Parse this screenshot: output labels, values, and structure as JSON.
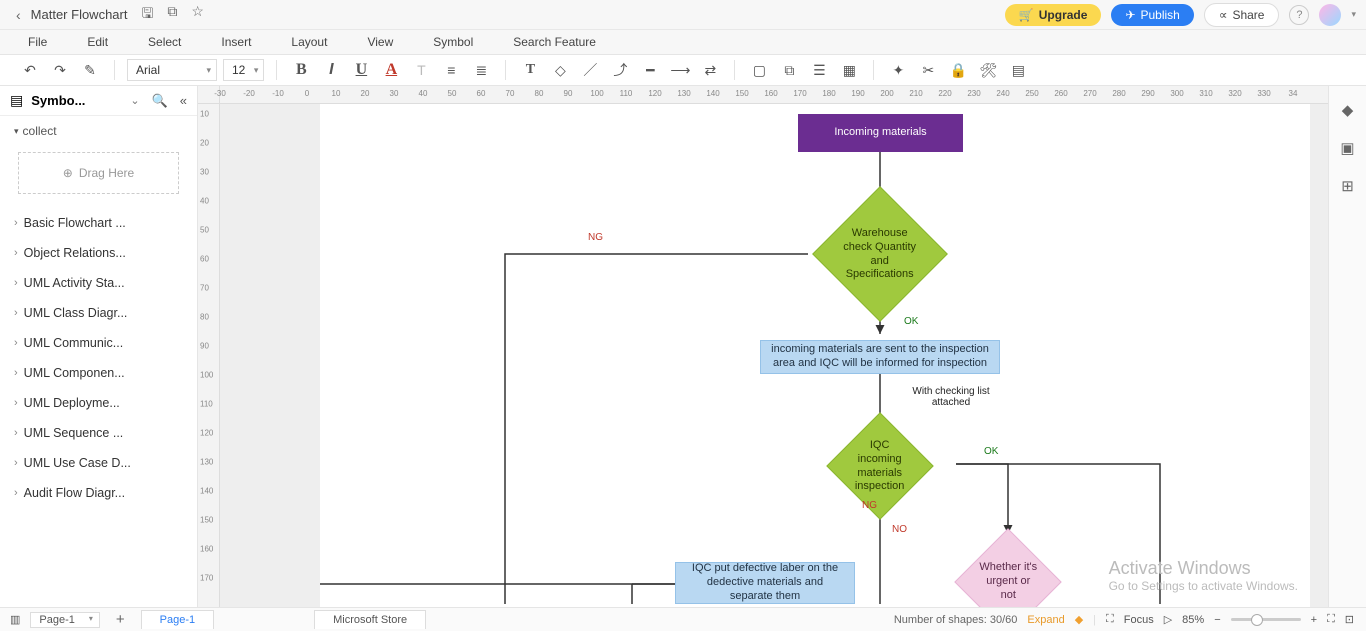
{
  "title": "Matter Flowchart",
  "menu": {
    "file": "File",
    "edit": "Edit",
    "select": "Select",
    "insert": "Insert",
    "layout": "Layout",
    "view": "View",
    "symbol": "Symbol",
    "search": "Search Feature"
  },
  "header_buttons": {
    "upgrade": "Upgrade",
    "publish": "Publish",
    "share": "Share"
  },
  "toolbar": {
    "font": "Arial",
    "font_size": "12"
  },
  "left_panel": {
    "header": "Symbo...",
    "collect": "collect",
    "drag": "Drag Here",
    "items": [
      "Basic Flowchart ...",
      "Object Relations...",
      "UML Activity Sta...",
      "UML Class Diagr...",
      "UML Communic...",
      "UML Componen...",
      "UML Deployme...",
      "UML Sequence ...",
      "UML Use Case D...",
      "Audit Flow Diagr..."
    ]
  },
  "hruler": [
    "-30",
    "-20",
    "-10",
    "0",
    "10",
    "20",
    "30",
    "40",
    "50",
    "60",
    "70",
    "80",
    "90",
    "100",
    "110",
    "120",
    "130",
    "140",
    "150",
    "160",
    "170",
    "180",
    "190",
    "200",
    "210",
    "220",
    "230",
    "240",
    "250",
    "260",
    "270",
    "280",
    "290",
    "300",
    "310",
    "320",
    "330",
    "34"
  ],
  "vruler": [
    "10",
    "20",
    "30",
    "40",
    "50",
    "60",
    "70",
    "80",
    "90",
    "100",
    "110",
    "120",
    "130",
    "140",
    "150",
    "160",
    "170"
  ],
  "nodes": {
    "incoming": "Incoming materials",
    "warehouse": "Warehouse check Quantity and Specifications",
    "send_iqc": "incoming materials are sent to the inspection area and IQC will be informed for inspection",
    "checking": "With checking list attached",
    "iqc_inspect": "IQC incoming materials inspection",
    "urgent": "Whether it's urgent or not",
    "defective": "IQC put defective laber on the dedective materials and separate them"
  },
  "labels": {
    "ng": "NG",
    "ok": "OK",
    "no": "NO"
  },
  "statusbar": {
    "page": "Page-1",
    "tab_page": "Page-1",
    "tab_ms": "Microsoft Store",
    "shapes": "Number of shapes: 30/60",
    "expand": "Expand",
    "focus": "Focus",
    "zoom": "85%"
  },
  "watermark": {
    "line1": "Activate Windows",
    "line2": "Go to Settings to activate Windows."
  }
}
